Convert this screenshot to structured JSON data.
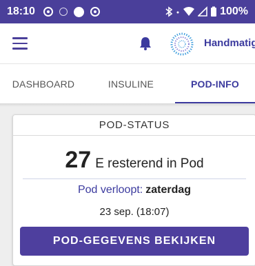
{
  "status_bar": {
    "time": "18:10",
    "battery": "100%"
  },
  "app_bar": {
    "mode_label": "Handmatig"
  },
  "tabs": [
    {
      "label": "DASHBOARD",
      "selected": false
    },
    {
      "label": "INSULINE",
      "selected": false
    },
    {
      "label": "POD-INFO",
      "selected": true
    }
  ],
  "pod_status": {
    "header": "POD-STATUS",
    "remaining_value": "27",
    "remaining_unit": "E resterend in Pod",
    "expiry_label": "Pod verloopt:",
    "expiry_day": "zaterdag",
    "expiry_date": "23 sep. (18:07)",
    "button_label": "POD-GEGEVENS BEKIJKEN"
  },
  "colors": {
    "status_bar": "#4a3f9a",
    "accent": "#3b3a9e",
    "button": "#4e3f9e"
  },
  "icons": [
    "menu-icon",
    "bell-icon",
    "mode-ring-icon",
    "bluetooth-icon",
    "wifi-icon",
    "signal-icon",
    "battery-icon"
  ]
}
